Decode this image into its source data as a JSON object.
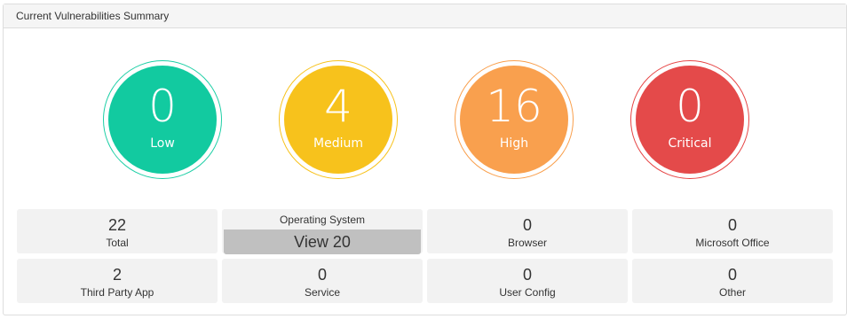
{
  "panel": {
    "title": "Current Vulnerabilities Summary"
  },
  "severity": {
    "low": {
      "count": "0",
      "label": "Low",
      "color": "#12caa0"
    },
    "medium": {
      "count": "4",
      "label": "Medium",
      "color": "#f7c21c"
    },
    "high": {
      "count": "16",
      "label": "High",
      "color": "#f9a04e"
    },
    "critical": {
      "count": "0",
      "label": "Critical",
      "color": "#e44a4a"
    }
  },
  "categories": {
    "total": {
      "value": "22",
      "label": "Total"
    },
    "operating_system": {
      "label": "Operating System",
      "button": "View 20"
    },
    "browser": {
      "value": "0",
      "label": "Browser"
    },
    "microsoft_office": {
      "value": "0",
      "label": "Microsoft Office"
    },
    "third_party_app": {
      "value": "2",
      "label": "Third Party App"
    },
    "service": {
      "value": "0",
      "label": "Service"
    },
    "user_config": {
      "value": "0",
      "label": "User Config"
    },
    "other": {
      "value": "0",
      "label": "Other"
    }
  }
}
